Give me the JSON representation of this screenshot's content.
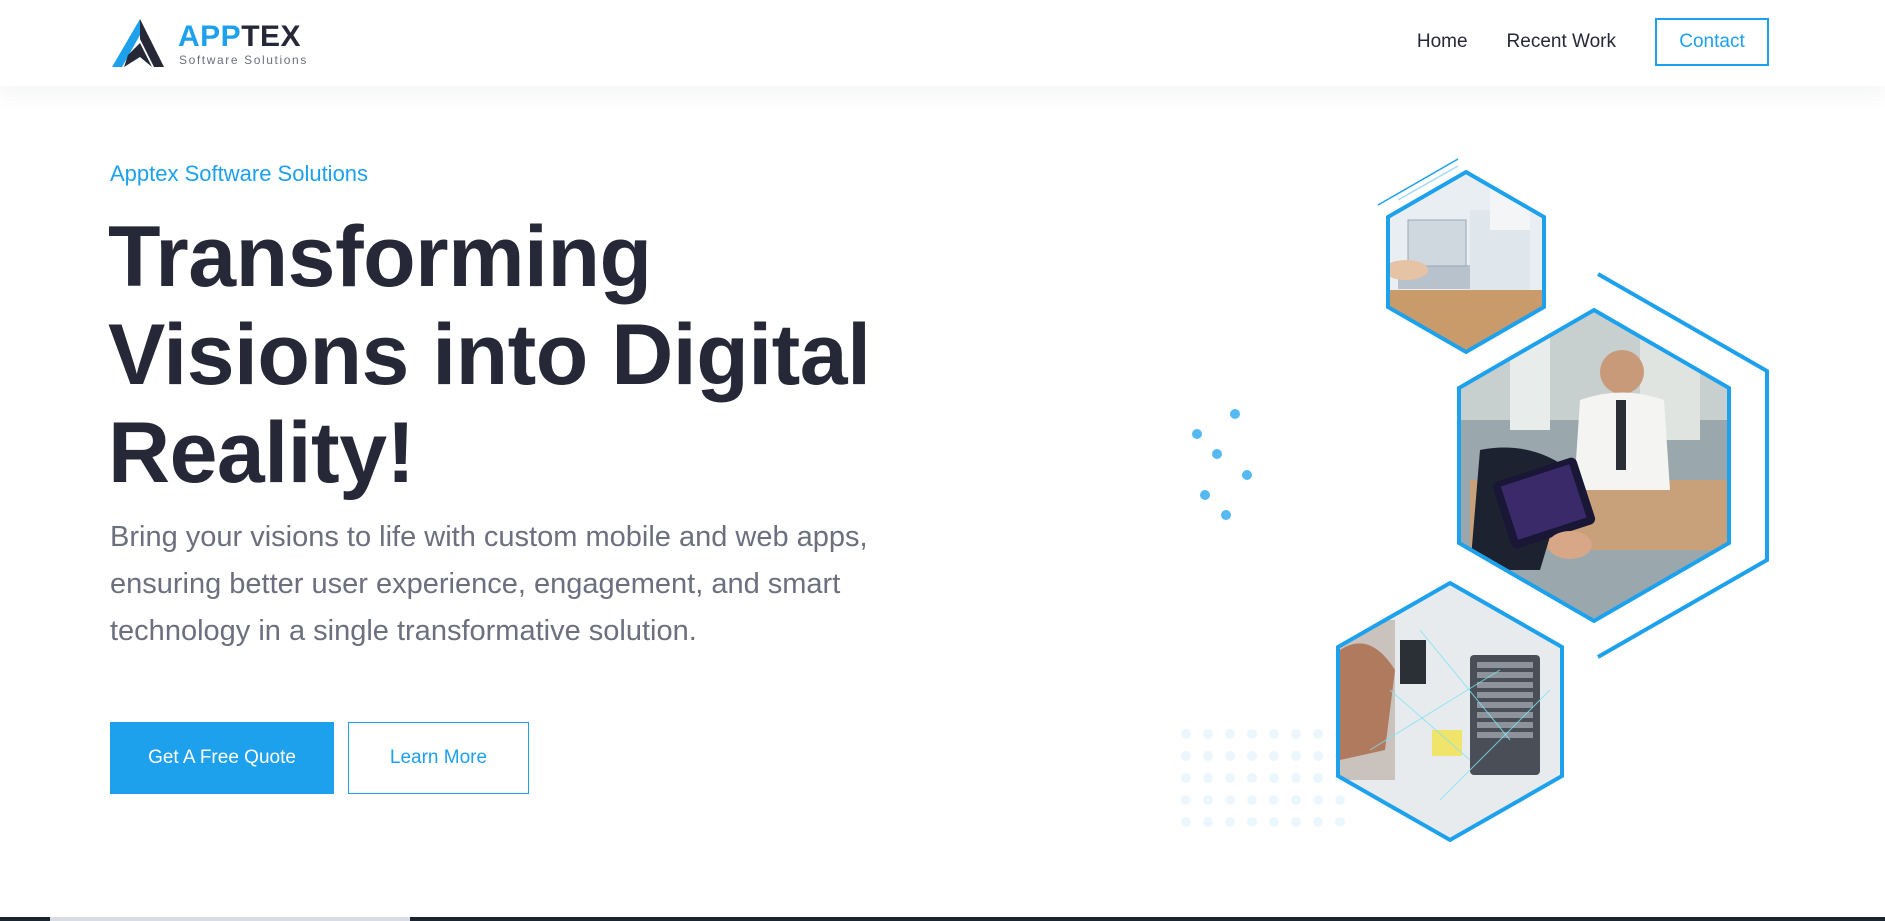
{
  "header": {
    "logo": {
      "word_part1": "APP",
      "word_part2": "TEX",
      "tagline": "Software Solutions"
    },
    "nav": {
      "home": "Home",
      "recent_work": "Recent Work",
      "contact": "Contact"
    }
  },
  "hero": {
    "eyebrow": "Apptex Software Solutions",
    "headline_lines": [
      "Transforming",
      "Visions into Digital",
      "Reality!"
    ],
    "subtext": "Bring your visions to life with custom mobile and web apps, ensuring better user experience, engagement, and smart technology in a single transformative solution.",
    "primary_button": "Get A Free Quote",
    "secondary_button": "Learn More"
  },
  "colors": {
    "accent": "#1da1ec",
    "heading": "#262838",
    "body_text": "#6b6f7e",
    "background": "#ffffff"
  },
  "icons": {
    "logo": "apptex-logo-icon"
  }
}
